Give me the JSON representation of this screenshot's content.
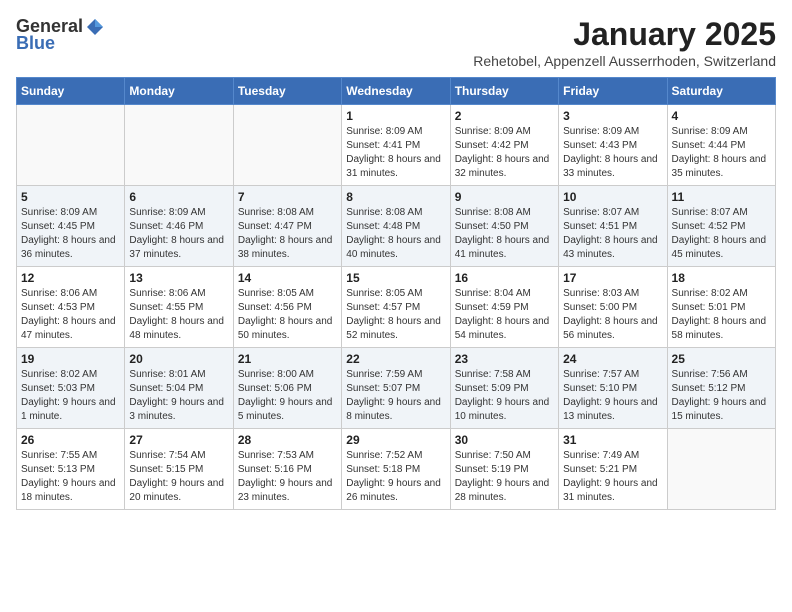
{
  "header": {
    "logo_general": "General",
    "logo_blue": "Blue",
    "month_title": "January 2025",
    "subtitle": "Rehetobel, Appenzell Ausserrhoden, Switzerland"
  },
  "weekdays": [
    "Sunday",
    "Monday",
    "Tuesday",
    "Wednesday",
    "Thursday",
    "Friday",
    "Saturday"
  ],
  "weeks": [
    [
      {
        "day": "",
        "info": ""
      },
      {
        "day": "",
        "info": ""
      },
      {
        "day": "",
        "info": ""
      },
      {
        "day": "1",
        "info": "Sunrise: 8:09 AM\nSunset: 4:41 PM\nDaylight: 8 hours and 31 minutes."
      },
      {
        "day": "2",
        "info": "Sunrise: 8:09 AM\nSunset: 4:42 PM\nDaylight: 8 hours and 32 minutes."
      },
      {
        "day": "3",
        "info": "Sunrise: 8:09 AM\nSunset: 4:43 PM\nDaylight: 8 hours and 33 minutes."
      },
      {
        "day": "4",
        "info": "Sunrise: 8:09 AM\nSunset: 4:44 PM\nDaylight: 8 hours and 35 minutes."
      }
    ],
    [
      {
        "day": "5",
        "info": "Sunrise: 8:09 AM\nSunset: 4:45 PM\nDaylight: 8 hours and 36 minutes."
      },
      {
        "day": "6",
        "info": "Sunrise: 8:09 AM\nSunset: 4:46 PM\nDaylight: 8 hours and 37 minutes."
      },
      {
        "day": "7",
        "info": "Sunrise: 8:08 AM\nSunset: 4:47 PM\nDaylight: 8 hours and 38 minutes."
      },
      {
        "day": "8",
        "info": "Sunrise: 8:08 AM\nSunset: 4:48 PM\nDaylight: 8 hours and 40 minutes."
      },
      {
        "day": "9",
        "info": "Sunrise: 8:08 AM\nSunset: 4:50 PM\nDaylight: 8 hours and 41 minutes."
      },
      {
        "day": "10",
        "info": "Sunrise: 8:07 AM\nSunset: 4:51 PM\nDaylight: 8 hours and 43 minutes."
      },
      {
        "day": "11",
        "info": "Sunrise: 8:07 AM\nSunset: 4:52 PM\nDaylight: 8 hours and 45 minutes."
      }
    ],
    [
      {
        "day": "12",
        "info": "Sunrise: 8:06 AM\nSunset: 4:53 PM\nDaylight: 8 hours and 47 minutes."
      },
      {
        "day": "13",
        "info": "Sunrise: 8:06 AM\nSunset: 4:55 PM\nDaylight: 8 hours and 48 minutes."
      },
      {
        "day": "14",
        "info": "Sunrise: 8:05 AM\nSunset: 4:56 PM\nDaylight: 8 hours and 50 minutes."
      },
      {
        "day": "15",
        "info": "Sunrise: 8:05 AM\nSunset: 4:57 PM\nDaylight: 8 hours and 52 minutes."
      },
      {
        "day": "16",
        "info": "Sunrise: 8:04 AM\nSunset: 4:59 PM\nDaylight: 8 hours and 54 minutes."
      },
      {
        "day": "17",
        "info": "Sunrise: 8:03 AM\nSunset: 5:00 PM\nDaylight: 8 hours and 56 minutes."
      },
      {
        "day": "18",
        "info": "Sunrise: 8:02 AM\nSunset: 5:01 PM\nDaylight: 8 hours and 58 minutes."
      }
    ],
    [
      {
        "day": "19",
        "info": "Sunrise: 8:02 AM\nSunset: 5:03 PM\nDaylight: 9 hours and 1 minute."
      },
      {
        "day": "20",
        "info": "Sunrise: 8:01 AM\nSunset: 5:04 PM\nDaylight: 9 hours and 3 minutes."
      },
      {
        "day": "21",
        "info": "Sunrise: 8:00 AM\nSunset: 5:06 PM\nDaylight: 9 hours and 5 minutes."
      },
      {
        "day": "22",
        "info": "Sunrise: 7:59 AM\nSunset: 5:07 PM\nDaylight: 9 hours and 8 minutes."
      },
      {
        "day": "23",
        "info": "Sunrise: 7:58 AM\nSunset: 5:09 PM\nDaylight: 9 hours and 10 minutes."
      },
      {
        "day": "24",
        "info": "Sunrise: 7:57 AM\nSunset: 5:10 PM\nDaylight: 9 hours and 13 minutes."
      },
      {
        "day": "25",
        "info": "Sunrise: 7:56 AM\nSunset: 5:12 PM\nDaylight: 9 hours and 15 minutes."
      }
    ],
    [
      {
        "day": "26",
        "info": "Sunrise: 7:55 AM\nSunset: 5:13 PM\nDaylight: 9 hours and 18 minutes."
      },
      {
        "day": "27",
        "info": "Sunrise: 7:54 AM\nSunset: 5:15 PM\nDaylight: 9 hours and 20 minutes."
      },
      {
        "day": "28",
        "info": "Sunrise: 7:53 AM\nSunset: 5:16 PM\nDaylight: 9 hours and 23 minutes."
      },
      {
        "day": "29",
        "info": "Sunrise: 7:52 AM\nSunset: 5:18 PM\nDaylight: 9 hours and 26 minutes."
      },
      {
        "day": "30",
        "info": "Sunrise: 7:50 AM\nSunset: 5:19 PM\nDaylight: 9 hours and 28 minutes."
      },
      {
        "day": "31",
        "info": "Sunrise: 7:49 AM\nSunset: 5:21 PM\nDaylight: 9 hours and 31 minutes."
      },
      {
        "day": "",
        "info": ""
      }
    ]
  ]
}
